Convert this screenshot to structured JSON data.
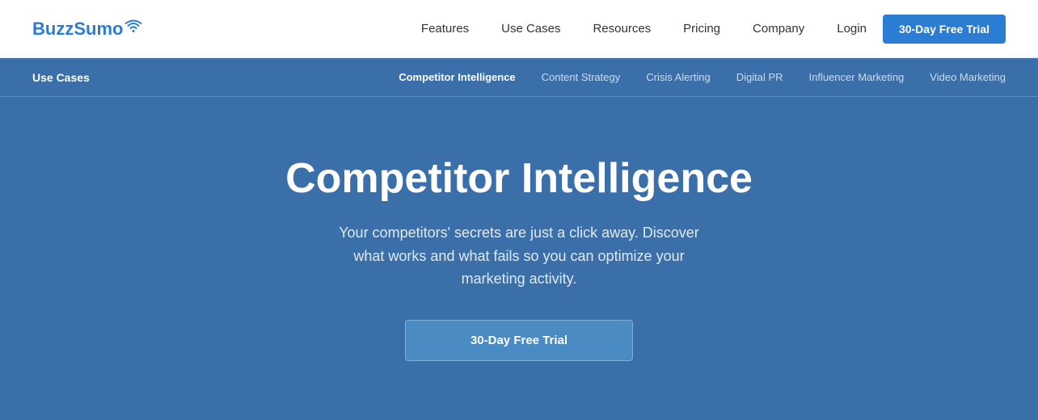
{
  "logo": {
    "text": "BuzzSumo",
    "icon": "◎"
  },
  "nav": {
    "links": [
      {
        "label": "Features",
        "id": "features"
      },
      {
        "label": "Use Cases",
        "id": "use-cases"
      },
      {
        "label": "Resources",
        "id": "resources"
      },
      {
        "label": "Pricing",
        "id": "pricing"
      },
      {
        "label": "Company",
        "id": "company"
      }
    ],
    "login_label": "Login",
    "trial_label": "30-Day Free Trial"
  },
  "sub_nav": {
    "title": "Use Cases",
    "links": [
      {
        "label": "Competitor Intelligence",
        "active": true
      },
      {
        "label": "Content Strategy",
        "active": false
      },
      {
        "label": "Crisis Alerting",
        "active": false
      },
      {
        "label": "Digital PR",
        "active": false
      },
      {
        "label": "Influencer Marketing",
        "active": false
      },
      {
        "label": "Video Marketing",
        "active": false
      }
    ]
  },
  "hero": {
    "title": "Competitor Intelligence",
    "subtitle": "Your competitors' secrets are just a click away. Discover what works and what fails so you can optimize your marketing activity.",
    "cta_label": "30-Day Free Trial"
  },
  "colors": {
    "primary": "#2b7cd3",
    "nav_bg": "#ffffff",
    "hero_bg": "#3a6faa",
    "sub_nav_bg": "#3a6faa"
  }
}
